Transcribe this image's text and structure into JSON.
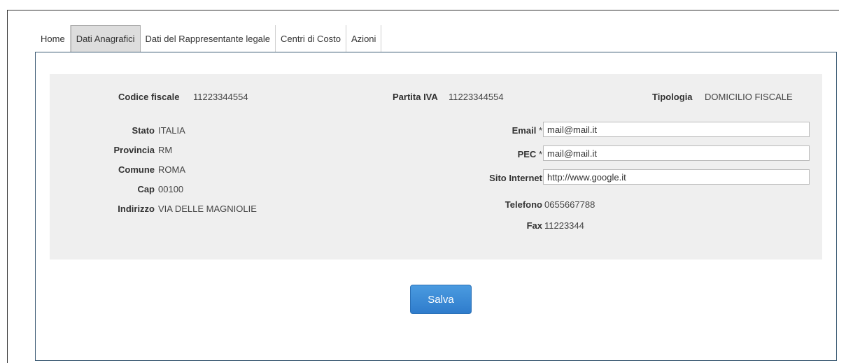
{
  "tabs": [
    {
      "label": "Home"
    },
    {
      "label": "Dati Anagrafici"
    },
    {
      "label": "Dati del Rappresentante legale"
    },
    {
      "label": "Centri di Costo"
    },
    {
      "label": "Azioni"
    }
  ],
  "top_row": {
    "codice_fiscale": {
      "label": "Codice fiscale",
      "value": "11223344554"
    },
    "partita_iva": {
      "label": "Partita IVA",
      "value": "11223344554"
    },
    "tipologia": {
      "label": "Tipologia",
      "value": "DOMICILIO FISCALE"
    }
  },
  "left": {
    "stato": {
      "label": "Stato",
      "value": "ITALIA"
    },
    "provincia": {
      "label": "Provincia",
      "value": "RM"
    },
    "comune": {
      "label": "Comune",
      "value": "ROMA"
    },
    "cap": {
      "label": "Cap",
      "value": "00100"
    },
    "indirizzo": {
      "label": "Indirizzo",
      "value": "VIA DELLE MAGNIOLIE"
    }
  },
  "right": {
    "email": {
      "label": "Email",
      "required_mark": "*",
      "value": "mail@mail.it"
    },
    "pec": {
      "label": "PEC",
      "required_mark": "*",
      "value": "mail@mail.it"
    },
    "sito": {
      "label": "Sito Internet",
      "value": "http://www.google.it"
    },
    "telefono": {
      "label": "Telefono",
      "value": "0655667788"
    },
    "fax": {
      "label": "Fax",
      "value": "11223344"
    }
  },
  "actions": {
    "save_label": "Salva"
  },
  "colors": {
    "accent": "#2f7ccc",
    "panel_border": "#3b5a73",
    "active_tab_underline": "#3a4e63",
    "gray_box": "#efefef"
  }
}
